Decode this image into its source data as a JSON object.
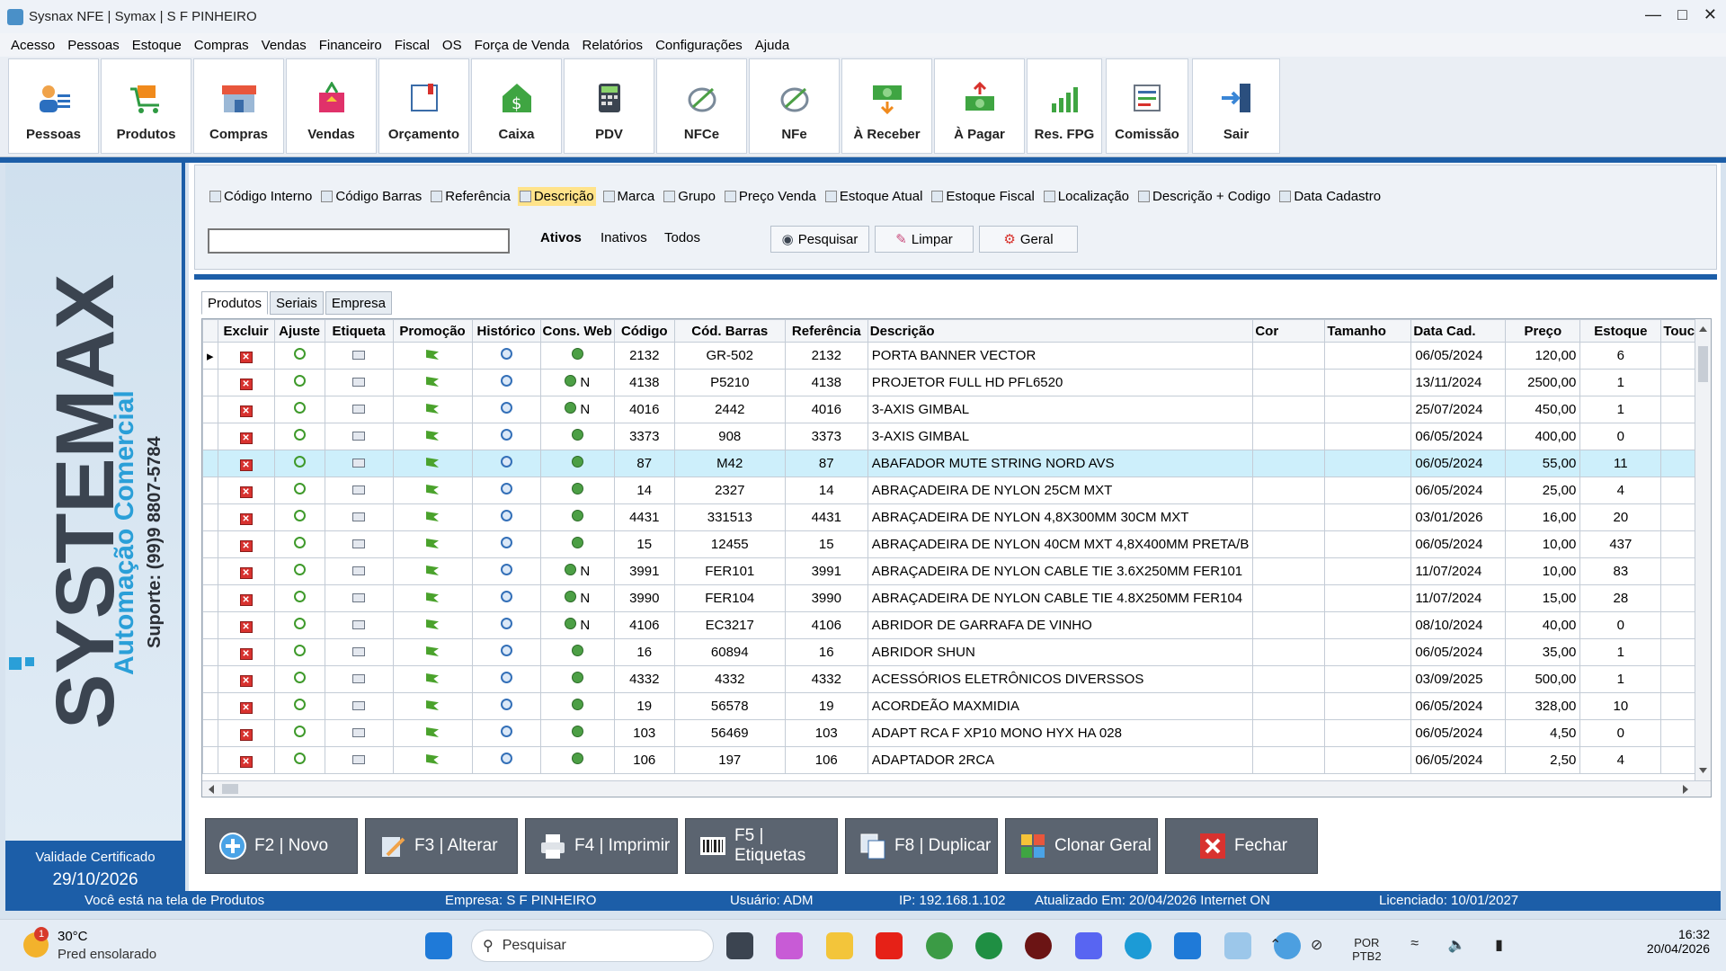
{
  "window": {
    "title": "Sysnax NFE | Symax | S F PINHEIRO"
  },
  "menu": [
    "Acesso",
    "Pessoas",
    "Estoque",
    "Compras",
    "Vendas",
    "Financeiro",
    "Fiscal",
    "OS",
    "Força de Venda",
    "Relatórios",
    "Configurações",
    "Ajuda"
  ],
  "toolbar": [
    {
      "label": "Pessoas",
      "icon": "people-icon"
    },
    {
      "label": "Produtos",
      "icon": "cart-icon"
    },
    {
      "label": "Compras",
      "icon": "store-icon"
    },
    {
      "label": "Vendas",
      "icon": "shopping-bag-icon"
    },
    {
      "label": "Orçamento",
      "icon": "book-icon"
    },
    {
      "label": "Caixa",
      "icon": "cash-house-icon"
    },
    {
      "label": "PDV",
      "icon": "calculator-icon"
    },
    {
      "label": "NFCe",
      "icon": "nfce-icon"
    },
    {
      "label": "NFe",
      "icon": "nfe-icon"
    },
    {
      "label": "À Receber",
      "icon": "money-in-icon"
    },
    {
      "label": "À Pagar",
      "icon": "money-out-icon"
    },
    {
      "label": "Res. FPG",
      "icon": "chart-icon"
    },
    {
      "label": "Comissão",
      "icon": "commission-icon"
    },
    {
      "label": "Sair",
      "icon": "exit-icon"
    }
  ],
  "sidebar": {
    "logo_text": "SYSTEMAX",
    "logo_sub": "Automação Comercial",
    "support": "Suporte: (99)9 8807-5784",
    "validade_label": "Validade Certificado",
    "validade_date": "29/10/2026"
  },
  "search": {
    "filters": [
      {
        "label": "Código Interno",
        "selected": false
      },
      {
        "label": "Código Barras",
        "selected": false
      },
      {
        "label": "Referência",
        "selected": false
      },
      {
        "label": "Descrição",
        "selected": true
      },
      {
        "label": "Marca",
        "selected": false
      },
      {
        "label": "Grupo",
        "selected": false
      },
      {
        "label": "Preço Venda",
        "selected": false
      },
      {
        "label": "Estoque Atual",
        "selected": false
      },
      {
        "label": "Estoque Fiscal",
        "selected": false
      },
      {
        "label": "Localização",
        "selected": false
      },
      {
        "label": "Descrição + Codigo",
        "selected": false
      },
      {
        "label": "Data Cadastro",
        "selected": false
      }
    ],
    "value": "",
    "status_ativos": "Ativos",
    "status_inativos": "Inativos",
    "status_todos": "Todos",
    "btn_pesquisar": "Pesquisar",
    "btn_limpar": "Limpar",
    "btn_geral": "Geral"
  },
  "tabs": [
    "Produtos",
    "Seriais",
    "Empresa"
  ],
  "table": {
    "headers": [
      "Excluir",
      "Ajuste",
      "Etiqueta",
      "Promoção",
      "Histórico",
      "Cons. Web",
      "Código",
      "Cód. Barras",
      "Referência",
      "Descrição",
      "Cor",
      "Tamanho",
      "Data Cad.",
      "Preço",
      "Estoque",
      "Touc"
    ],
    "rows": [
      {
        "web": "",
        "codigo": "2132",
        "barras": "GR-502",
        "ref": "2132",
        "desc": "PORTA BANNER VECTOR",
        "cor": "",
        "tam": "",
        "data": "06/05/2024",
        "preco": "120,00",
        "estoque": "6"
      },
      {
        "web": "N",
        "codigo": "4138",
        "barras": "P5210",
        "ref": "4138",
        "desc": "PROJETOR FULL HD PFL6520",
        "cor": "",
        "tam": "",
        "data": "13/11/2024",
        "preco": "2500,00",
        "estoque": "1"
      },
      {
        "web": "N",
        "codigo": "4016",
        "barras": "2442",
        "ref": "4016",
        "desc": "3-AXIS GIMBAL",
        "cor": "",
        "tam": "",
        "data": "25/07/2024",
        "preco": "450,00",
        "estoque": "1"
      },
      {
        "web": "",
        "codigo": "3373",
        "barras": "908",
        "ref": "3373",
        "desc": "3-AXIS GIMBAL",
        "cor": "",
        "tam": "",
        "data": "06/05/2024",
        "preco": "400,00",
        "estoque": "0"
      },
      {
        "web": "",
        "codigo": "87",
        "barras": "M42",
        "ref": "87",
        "desc": "ABAFADOR MUTE STRING NORD AVS",
        "cor": "",
        "tam": "",
        "data": "06/05/2024",
        "preco": "55,00",
        "estoque": "11"
      },
      {
        "web": "",
        "codigo": "14",
        "barras": "2327",
        "ref": "14",
        "desc": "ABRAÇADEIRA DE NYLON 25CM MXT",
        "cor": "",
        "tam": "",
        "data": "06/05/2024",
        "preco": "25,00",
        "estoque": "4"
      },
      {
        "web": "",
        "codigo": "4431",
        "barras": "331513",
        "ref": "4431",
        "desc": "ABRAÇADEIRA DE NYLON 4,8X300MM 30CM MXT",
        "cor": "",
        "tam": "",
        "data": "03/01/2026",
        "preco": "16,00",
        "estoque": "20"
      },
      {
        "web": "",
        "codigo": "15",
        "barras": "12455",
        "ref": "15",
        "desc": "ABRAÇADEIRA DE NYLON 40CM MXT 4,8X400MM PRETA/B",
        "cor": "",
        "tam": "",
        "data": "06/05/2024",
        "preco": "10,00",
        "estoque": "437"
      },
      {
        "web": "N",
        "codigo": "3991",
        "barras": "FER101",
        "ref": "3991",
        "desc": "ABRAÇADEIRA DE NYLON CABLE TIE 3.6X250MM FER101",
        "cor": "",
        "tam": "",
        "data": "11/07/2024",
        "preco": "10,00",
        "estoque": "83"
      },
      {
        "web": "N",
        "codigo": "3990",
        "barras": "FER104",
        "ref": "3990",
        "desc": "ABRAÇADEIRA DE NYLON CABLE TIE 4.8X250MM FER104",
        "cor": "",
        "tam": "",
        "data": "11/07/2024",
        "preco": "15,00",
        "estoque": "28"
      },
      {
        "web": "N",
        "codigo": "4106",
        "barras": "EC3217",
        "ref": "4106",
        "desc": "ABRIDOR DE GARRAFA DE VINHO",
        "cor": "",
        "tam": "",
        "data": "08/10/2024",
        "preco": "40,00",
        "estoque": "0"
      },
      {
        "web": "",
        "codigo": "16",
        "barras": "60894",
        "ref": "16",
        "desc": "ABRIDOR SHUN",
        "cor": "",
        "tam": "",
        "data": "06/05/2024",
        "preco": "35,00",
        "estoque": "1"
      },
      {
        "web": "",
        "codigo": "4332",
        "barras": "4332",
        "ref": "4332",
        "desc": "ACESSÓRIOS ELETRÔNICOS DIVERSSOS",
        "cor": "",
        "tam": "",
        "data": "03/09/2025",
        "preco": "500,00",
        "estoque": "1"
      },
      {
        "web": "",
        "codigo": "19",
        "barras": "56578",
        "ref": "19",
        "desc": "ACORDEÃO MAXMIDIA",
        "cor": "",
        "tam": "",
        "data": "06/05/2024",
        "preco": "328,00",
        "estoque": "10"
      },
      {
        "web": "",
        "codigo": "103",
        "barras": "56469",
        "ref": "103",
        "desc": "ADAPT RCA F XP10 MONO HYX HA 028",
        "cor": "",
        "tam": "",
        "data": "06/05/2024",
        "preco": "4,50",
        "estoque": "0"
      },
      {
        "web": "",
        "codigo": "106",
        "barras": "197",
        "ref": "106",
        "desc": "ADAPTADOR 2RCA",
        "cor": "",
        "tam": "",
        "data": "06/05/2024",
        "preco": "2,50",
        "estoque": "4"
      }
    ]
  },
  "actions": [
    {
      "label": "F2 | Novo",
      "icon": "plus-circle-icon"
    },
    {
      "label": "F3 | Alterar",
      "icon": "edit-icon"
    },
    {
      "label": "F4 | Imprimir",
      "icon": "printer-icon"
    },
    {
      "label": "F5 | Etiquetas",
      "icon": "barcode-icon"
    },
    {
      "label": "F8 | Duplicar",
      "icon": "duplicate-icon"
    },
    {
      "label": "Clonar Geral",
      "icon": "clone-icon"
    },
    {
      "label": "Fechar",
      "icon": "close-icon"
    }
  ],
  "status": {
    "tela": "Você está na tela de Produtos",
    "empresa": "Empresa: S F PINHEIRO",
    "usuario": "Usuário: ADM",
    "ip": "IP: 192.168.1.102",
    "atualizado": "Atualizado Em: 20/04/2026  Internet ON",
    "licenciado": "Licenciado: 10/01/2027"
  },
  "taskbar": {
    "temp": "30°C",
    "weather": "Pred ensolarado",
    "weather_badge": "1",
    "search_placeholder": "Pesquisar",
    "lang1": "POR",
    "lang2": "PTB2",
    "time": "16:32",
    "date": "20/04/2026"
  },
  "colors": {
    "accent": "#1c5ea8",
    "highlight_row": "#cdeffb",
    "selected_filter": "#ffe38a",
    "action_button": "#5b6470"
  }
}
